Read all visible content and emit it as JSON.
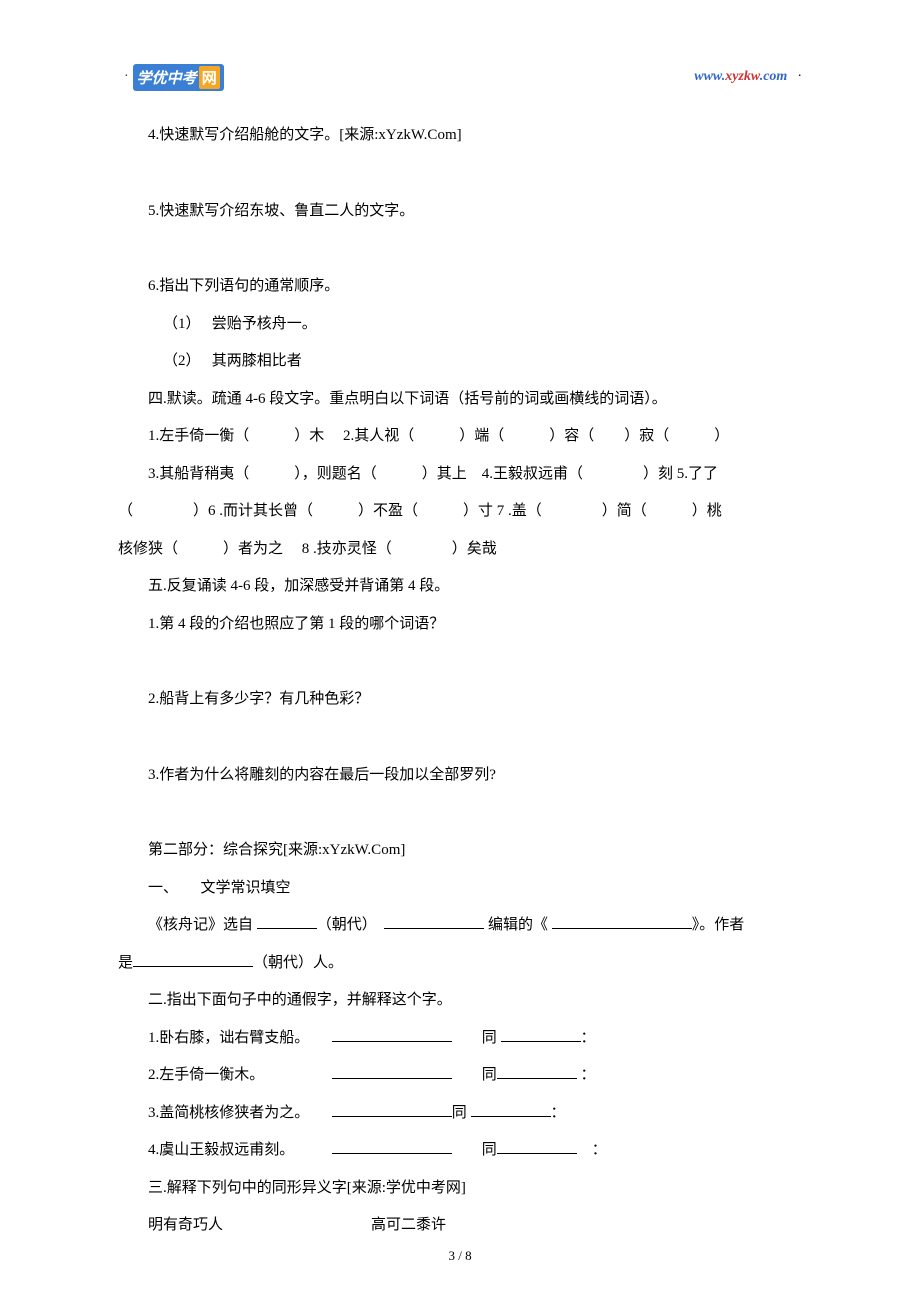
{
  "header": {
    "logo_text": "学优中考",
    "logo_suffix": "网",
    "url_www": "www.",
    "url_domain": "xyzkw",
    "url_com": ".com"
  },
  "content": {
    "q4": "4.快速默写介绍船舱的文字。[来源:xYzkW.Com]",
    "q5": "5.快速默写介绍东坡、鲁直二人的文字。",
    "q6": "6.指出下列语句的通常顺序。",
    "q6_1": "（1）　 尝贻予核舟一。",
    "q6_2": "（2）　 其两膝相比者",
    "section4": "四.默读。疏通 4-6 段文字。重点明白以下词语（括号前的词或画横线的词语）。",
    "s4_line1": "1.左手倚一衡（　　　）木　 2.其人视（　　　）端（　　　）容（　　）寂（　　　）",
    "s4_line2_indent": "3.其船背稍夷（　　　），则题名（　　　）其上　4.王毅叔远甫（　　　　）刻 5.了了",
    "s4_line3": "（　　　　）6 .而计其长曾（　　　）不盈（　　　）寸 7 .盖（　　　　）简（　　　）桃",
    "s4_line4": "核修狭（　　　）者为之　 8 .技亦灵怪（　　　　）矣哉",
    "section5": "五.反复诵读 4-6 段，加深感受并背诵第 4 段。",
    "s5_q1": "1.第 4 段的介绍也照应了第 1 段的哪个词语？",
    "s5_q2": "2.船背上有多少字？有几种色彩？",
    "s5_q3": "3.作者为什么将雕刻的内容在最后一段加以全部罗列?",
    "part2": "第二部分：综合探究[来源:xYzkW.Com]",
    "p2_s1": "一、　　文学常识填空",
    "p2_s1_text_a": "《核舟记》选自  ",
    "p2_s1_text_b": "（朝代）　",
    "p2_s1_text_c": "  编辑的《  ",
    "p2_s1_text_d": "》。作者",
    "p2_s1_line2_a": "是",
    "p2_s1_line2_b": "（朝代）人。",
    "p2_s2": "二.指出下面句子中的通假字，并解释这个字。",
    "p2_s2_1a": "1.卧右膝，诎右臂支船。　　",
    "p2_s2_1b": "　　同  ",
    "p2_s2_1c": "：",
    "p2_s2_2a": "2.左手倚一衡木。　　　　　",
    "p2_s2_2b": "　　同",
    "p2_s2_2c": "  ：",
    "p2_s2_3a": "3.盖简桃核修狭者为之。　　",
    "p2_s2_3b": "同  ",
    "p2_s2_3c": "：",
    "p2_s2_4a": "4.虞山王毅叔远甫刻。　　　",
    "p2_s2_4b": "　　同",
    "p2_s2_4c": "　：",
    "p2_s3": "三.解释下列句中的同形异义字[来源:学优中考网]",
    "p2_s3_line_a": "明有奇巧人",
    "p2_s3_line_b": "高可二黍许"
  },
  "footer": {
    "page": "3",
    "sep": "  /  ",
    "total": "8"
  }
}
